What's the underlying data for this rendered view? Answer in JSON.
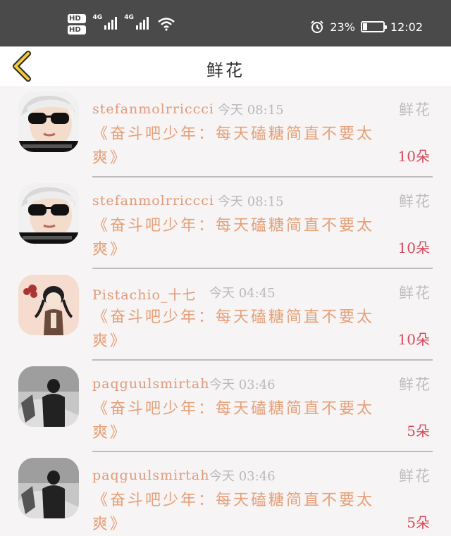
{
  "status_bar": {
    "sim1": "HD",
    "sim1_slot": "1",
    "sim2": "HD",
    "sim2_slot": "2",
    "net1": "4G",
    "net2": "4G",
    "battery_text": "23",
    "battery_level": 0.23,
    "time": "12:02",
    "icons": [
      "signal-icon",
      "wifi-icon",
      "alarm-icon",
      "battery-icon"
    ]
  },
  "header": {
    "title": "鲜花",
    "back_icon": "chevron-left-icon",
    "accent": "#e6b800"
  },
  "items": [
    {
      "user": "stefanmolrriccci",
      "time": "今天 08:15",
      "kind": "鲜花",
      "message": "《奋斗吧少年：每天磕糖简直不要太爽》",
      "count": "10朵",
      "avatar": "avatar-glasses-boy"
    },
    {
      "user": "stefanmolrriccci",
      "time": "今天 08:15",
      "kind": "鲜花",
      "message": "《奋斗吧少年：每天磕糖简直不要太爽》",
      "count": "10朵",
      "avatar": "avatar-glasses-boy"
    },
    {
      "user": "Pistachio_十七",
      "time": "今天 04:45",
      "kind": "鲜花",
      "message": "《奋斗吧少年：每天磕糖简直不要太爽》",
      "count": "10朵",
      "avatar": "avatar-cartoon-girl"
    },
    {
      "user": "paqguulsmirtah",
      "time": "今天 03:46",
      "kind": "鲜花",
      "message": "《奋斗吧少年：每天磕糖简直不要太爽》",
      "count": "5朵",
      "avatar": "avatar-snow-figure"
    },
    {
      "user": "paqguulsmirtah",
      "time": "今天 03:46",
      "kind": "鲜花",
      "message": "《奋斗吧少年：每天磕糖简直不要太爽》",
      "count": "5朵",
      "avatar": "avatar-snow-figure"
    }
  ],
  "colors": {
    "username": "#e19a7a",
    "message": "#e6a078",
    "count": "#d94a5c",
    "muted": "#b9b9b9",
    "statusbar": "#4a4a4a"
  }
}
